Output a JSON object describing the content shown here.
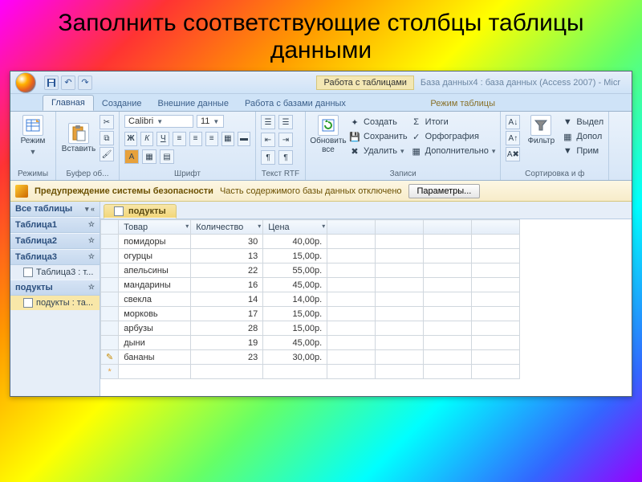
{
  "slide_title": "Заполнить соответствующие столбцы таблицы данными",
  "window_title": "База данных4 : база данных (Access 2007) - Micr",
  "context_group": "Работа с таблицами",
  "tabs": {
    "home": "Главная",
    "create": "Создание",
    "external": "Внешние данные",
    "dbtools": "Работа с базами данных",
    "datasheet": "Режим таблицы"
  },
  "ribbon": {
    "views_label": "Режимы",
    "view_btn": "Режим",
    "clipboard_label": "Буфер об...",
    "paste_btn": "Вставить",
    "font_label": "Шрифт",
    "font_name": "Calibri",
    "font_size": "11",
    "bold": "Ж",
    "italic": "К",
    "underline": "Ч",
    "rtf_label": "Текст RTF",
    "refresh_btn": "Обновить\nвсе",
    "records_label": "Записи",
    "rec_new": "Создать",
    "rec_save": "Сохранить",
    "rec_del": "Удалить",
    "rec_totals": "Итоги",
    "rec_spell": "Орфография",
    "rec_more": "Дополнительно",
    "sort_label": "Сортировка и ф",
    "filter_btn": "Фильтр",
    "sel": "Выдел",
    "adv": "Допол",
    "toggle": "Прим"
  },
  "security": {
    "label": "Предупреждение системы безопасности",
    "msg": "Часть содержимого базы данных отключено",
    "options": "Параметры..."
  },
  "nav": {
    "header": "Все таблицы",
    "g1": "Таблица1",
    "g2": "Таблица2",
    "g3": "Таблица3",
    "g3_item": "Таблица3 : т...",
    "g4": "подукты",
    "g4_item": "подукты : та..."
  },
  "doc_tab": "подукты",
  "columns": {
    "c1": "Товар",
    "c2": "Количество",
    "c3": "Цена"
  },
  "rows": [
    {
      "t": "помидоры",
      "q": "30",
      "p": "40,00р."
    },
    {
      "t": "огурцы",
      "q": "13",
      "p": "15,00р."
    },
    {
      "t": "апельсины",
      "q": "22",
      "p": "55,00р."
    },
    {
      "t": "мандарины",
      "q": "16",
      "p": "45,00р."
    },
    {
      "t": "свекла",
      "q": "14",
      "p": "14,00р."
    },
    {
      "t": "морковь",
      "q": "17",
      "p": "15,00р."
    },
    {
      "t": "арбузы",
      "q": "28",
      "p": "15,00р."
    },
    {
      "t": "дыни",
      "q": "19",
      "p": "45,00р."
    },
    {
      "t": "бананы",
      "q": "23",
      "p": "30,00р."
    }
  ]
}
